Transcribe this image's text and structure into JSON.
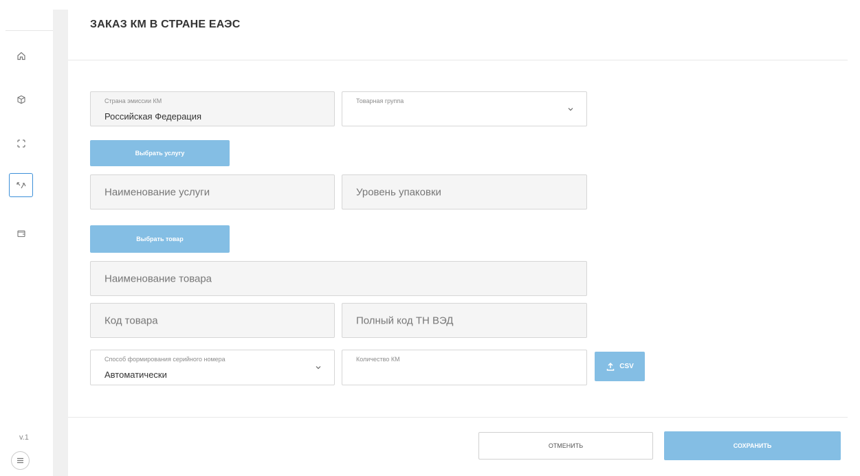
{
  "sidebar": {
    "icons": [
      {
        "name": "home-icon"
      },
      {
        "name": "box-icon"
      },
      {
        "name": "scan-icon"
      },
      {
        "name": "transfer-icon",
        "active": true
      },
      {
        "name": "wallet-icon"
      }
    ],
    "version": "v.1"
  },
  "header": {
    "title": "ЗАКАЗ КМ В СТРАНЕ ЕАЭС"
  },
  "form": {
    "country": {
      "label": "Страна эмиссии КМ",
      "value": "Российская Федерация"
    },
    "product_group": {
      "label": "Товарная группа",
      "value": ""
    },
    "choose_service_label": "Выбрать услугу",
    "service_name_placeholder": "Наименование услуги",
    "package_level_placeholder": "Уровень упаковки",
    "choose_product_label": "Выбрать товар",
    "product_name_placeholder": "Наименование товара",
    "product_code_placeholder": "Код товара",
    "tnved_placeholder": "Полный код ТН ВЭД",
    "serial_method": {
      "label": "Способ формирования серийного номера",
      "value": "Автоматически"
    },
    "km_quantity": {
      "label": "Количество КМ",
      "value": ""
    },
    "csv_label": "CSV"
  },
  "footer": {
    "cancel_label": "ОТМЕНИТЬ",
    "save_label": "СОХРАНИТЬ"
  },
  "colors": {
    "accent": "#84bee4",
    "active_border": "#3b8fd8"
  }
}
